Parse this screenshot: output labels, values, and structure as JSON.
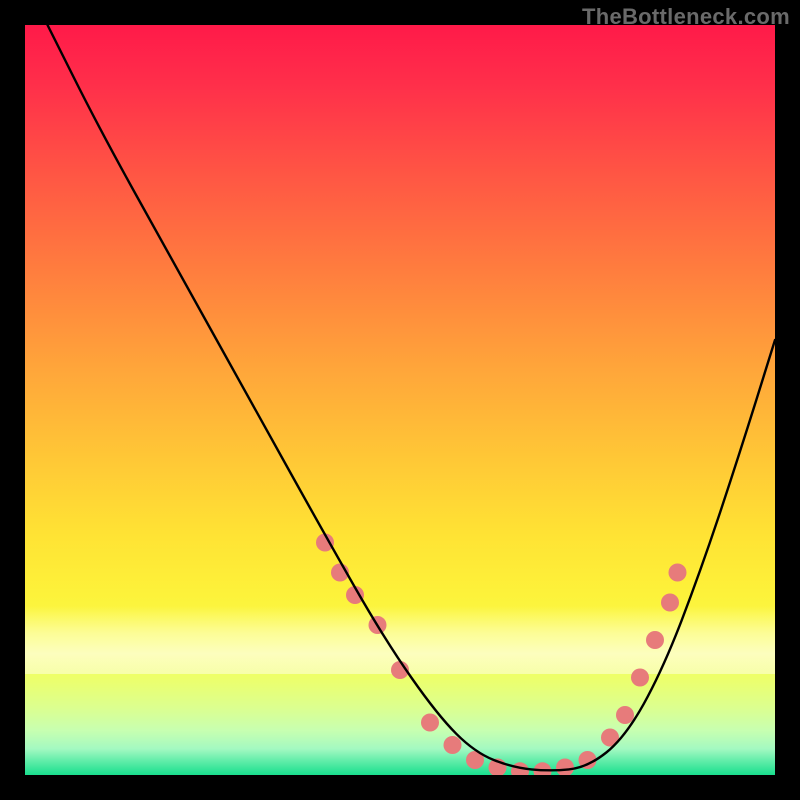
{
  "watermark": "TheBottleneck.com",
  "chart_data": {
    "type": "line",
    "title": "",
    "xlabel": "",
    "ylabel": "",
    "xlim": [
      0,
      100
    ],
    "ylim": [
      0,
      100
    ],
    "grid": false,
    "legend": false,
    "background_gradient": {
      "direction": "vertical",
      "stops": [
        {
          "pos": 0,
          "color": "#ff1a49"
        },
        {
          "pos": 0.2,
          "color": "#ff5644"
        },
        {
          "pos": 0.46,
          "color": "#ffa63a"
        },
        {
          "pos": 0.68,
          "color": "#ffe334"
        },
        {
          "pos": 0.82,
          "color": "#f8fc4a"
        },
        {
          "pos": 0.94,
          "color": "#c8ffb0"
        },
        {
          "pos": 1.0,
          "color": "#19df8e"
        }
      ]
    },
    "series": [
      {
        "name": "bottleneck-curve",
        "color": "#000000",
        "x": [
          3,
          10,
          20,
          30,
          40,
          48,
          55,
          60,
          65,
          70,
          75,
          80,
          85,
          90,
          95,
          100
        ],
        "y": [
          100,
          86,
          68,
          50,
          32,
          18,
          8,
          3,
          1,
          0.5,
          1,
          5,
          14,
          27,
          42,
          58
        ]
      }
    ],
    "markers": {
      "color": "#e77b7b",
      "radius_px": 9,
      "points": [
        {
          "x": 40,
          "y": 31
        },
        {
          "x": 42,
          "y": 27
        },
        {
          "x": 44,
          "y": 24
        },
        {
          "x": 47,
          "y": 20
        },
        {
          "x": 50,
          "y": 14
        },
        {
          "x": 54,
          "y": 7
        },
        {
          "x": 57,
          "y": 4
        },
        {
          "x": 60,
          "y": 2
        },
        {
          "x": 63,
          "y": 1
        },
        {
          "x": 66,
          "y": 0.5
        },
        {
          "x": 69,
          "y": 0.5
        },
        {
          "x": 72,
          "y": 1
        },
        {
          "x": 75,
          "y": 2
        },
        {
          "x": 78,
          "y": 5
        },
        {
          "x": 80,
          "y": 8
        },
        {
          "x": 82,
          "y": 13
        },
        {
          "x": 84,
          "y": 18
        },
        {
          "x": 86,
          "y": 23
        },
        {
          "x": 87,
          "y": 27
        }
      ]
    }
  }
}
